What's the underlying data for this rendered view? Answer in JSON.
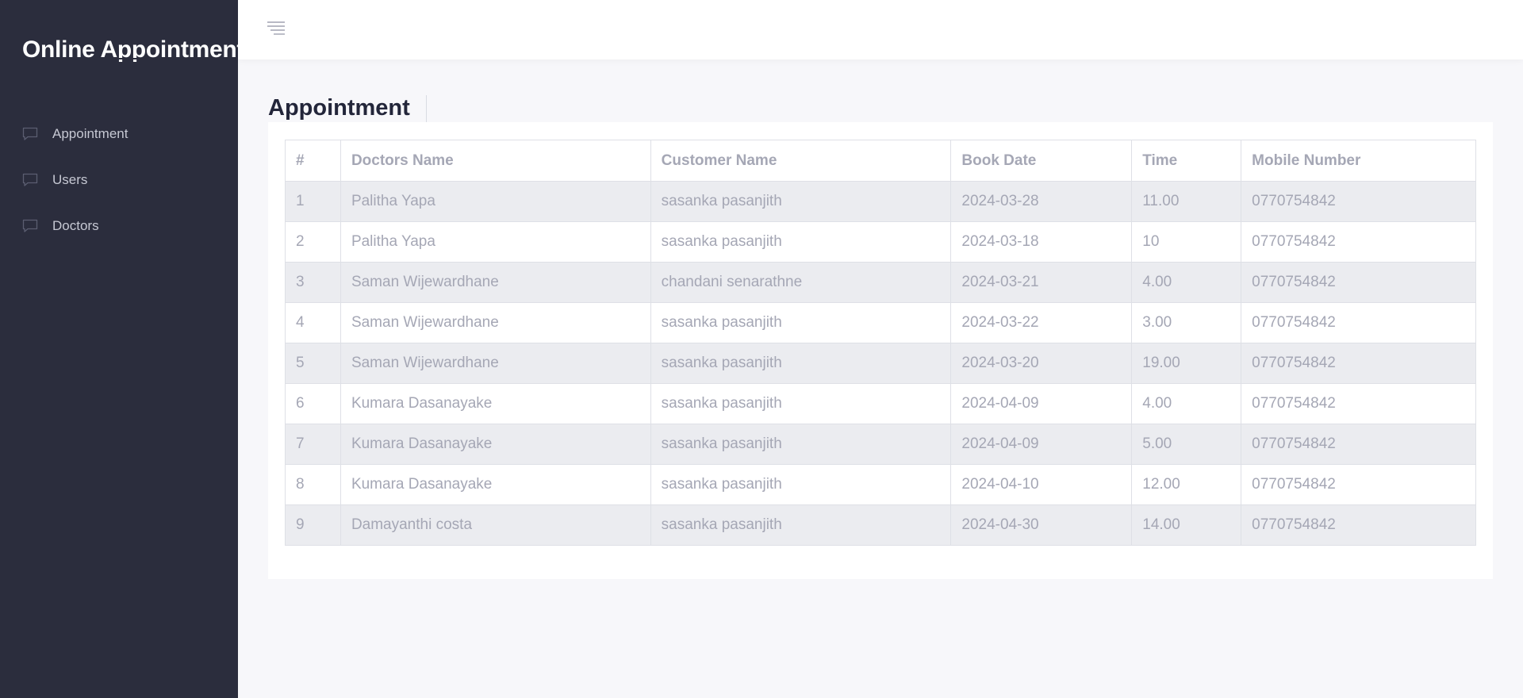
{
  "sidebar": {
    "brand": "Online Appointment",
    "items": [
      {
        "label": "Appointment",
        "icon": "chat-bubble-icon"
      },
      {
        "label": "Users",
        "icon": "chat-bubble-icon"
      },
      {
        "label": "Doctors",
        "icon": "chat-bubble-icon"
      }
    ]
  },
  "topbar": {
    "menu_icon": "hamburger-menu-icon"
  },
  "main": {
    "title": "Appointment"
  },
  "table": {
    "headers": [
      "#",
      "Doctors Name",
      "Customer Name",
      "Book Date",
      "Time",
      "Mobile Number"
    ],
    "rows": [
      [
        "1",
        "Palitha Yapa",
        "sasanka pasanjith",
        "2024-03-28",
        "11.00",
        "0770754842"
      ],
      [
        "2",
        "Palitha Yapa",
        "sasanka pasanjith",
        "2024-03-18",
        "10",
        "0770754842"
      ],
      [
        "3",
        "Saman Wijewardhane",
        "chandani senarathne",
        "2024-03-21",
        "4.00",
        "0770754842"
      ],
      [
        "4",
        "Saman Wijewardhane",
        "sasanka pasanjith",
        "2024-03-22",
        "3.00",
        "0770754842"
      ],
      [
        "5",
        "Saman Wijewardhane",
        "sasanka pasanjith",
        "2024-03-20",
        "19.00",
        "0770754842"
      ],
      [
        "6",
        "Kumara Dasanayake",
        "sasanka pasanjith",
        "2024-04-09",
        "4.00",
        "0770754842"
      ],
      [
        "7",
        "Kumara Dasanayake",
        "sasanka pasanjith",
        "2024-04-09",
        "5.00",
        "0770754842"
      ],
      [
        "8",
        "Kumara Dasanayake",
        "sasanka pasanjith",
        "2024-04-10",
        "12.00",
        "0770754842"
      ],
      [
        "9",
        "Damayanthi costa",
        "sasanka pasanjith",
        "2024-04-30",
        "14.00",
        "0770754842"
      ]
    ]
  },
  "colors": {
    "sidebar_bg": "#2b2d3d",
    "page_bg": "#f7f7fa",
    "striped_row": "#ebecf0",
    "text_muted": "#a5a7b5",
    "title_text": "#23263a"
  }
}
